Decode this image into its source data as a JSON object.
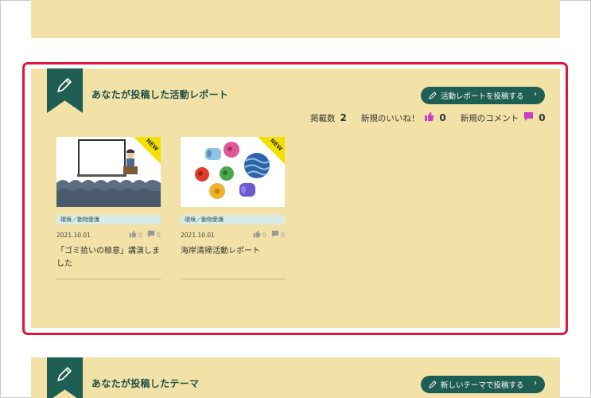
{
  "main_section": {
    "title": "あなたが投稿した活動レポート",
    "post_button_label": "活動レポートを投稿する",
    "post_button_chevron": "›",
    "stats": {
      "posts_label": "掲載数",
      "posts_value": "2",
      "likes_label": "新規のいいね！",
      "likes_value": "0",
      "comments_label": "新規のコメント",
      "comments_value": "0"
    },
    "cards": [
      {
        "badge": "NEW",
        "tag": "環境／動物愛護",
        "date": "2021.10.01",
        "likes": "0",
        "comments": "0",
        "title": "「ゴミ拾いの極意」講演しました"
      },
      {
        "badge": "NEW",
        "tag": "環境／動物愛護",
        "date": "2021.10.01",
        "likes": "0",
        "comments": "0",
        "title": "海岸清掃活動レポート"
      }
    ]
  },
  "bottom_section": {
    "title": "あなたが投稿したテーマ",
    "post_button_label": "新しいテーマで投稿する",
    "post_button_chevron": "›"
  },
  "colors": {
    "panel_bg": "#f3e2a8",
    "accent_green": "#1f5f53",
    "highlight_red": "#e0163b",
    "badge_yellow": "#f4e000",
    "like_pink": "#cc3fc0"
  }
}
